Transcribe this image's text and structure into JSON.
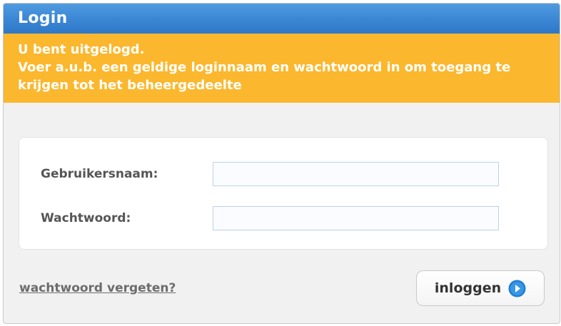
{
  "dialog": {
    "title": "Login"
  },
  "notice": {
    "line1": "U bent uitgelogd.",
    "line2": "Voer a.u.b. een geldige loginnaam en wachtwoord in om toegang te krijgen tot het beheergedeelte"
  },
  "form": {
    "username": {
      "label": "Gebruikersnaam:",
      "value": ""
    },
    "password": {
      "label": "Wachtwoord:",
      "value": ""
    }
  },
  "links": {
    "forgot_password": "wachtwoord vergeten?"
  },
  "buttons": {
    "login_label": "inloggen",
    "login_icon": "arrow-right-circle-icon"
  },
  "colors": {
    "title_bar": "#3b86d4",
    "notice_background": "#fbb72d",
    "icon_blue": "#1f7fd1"
  }
}
